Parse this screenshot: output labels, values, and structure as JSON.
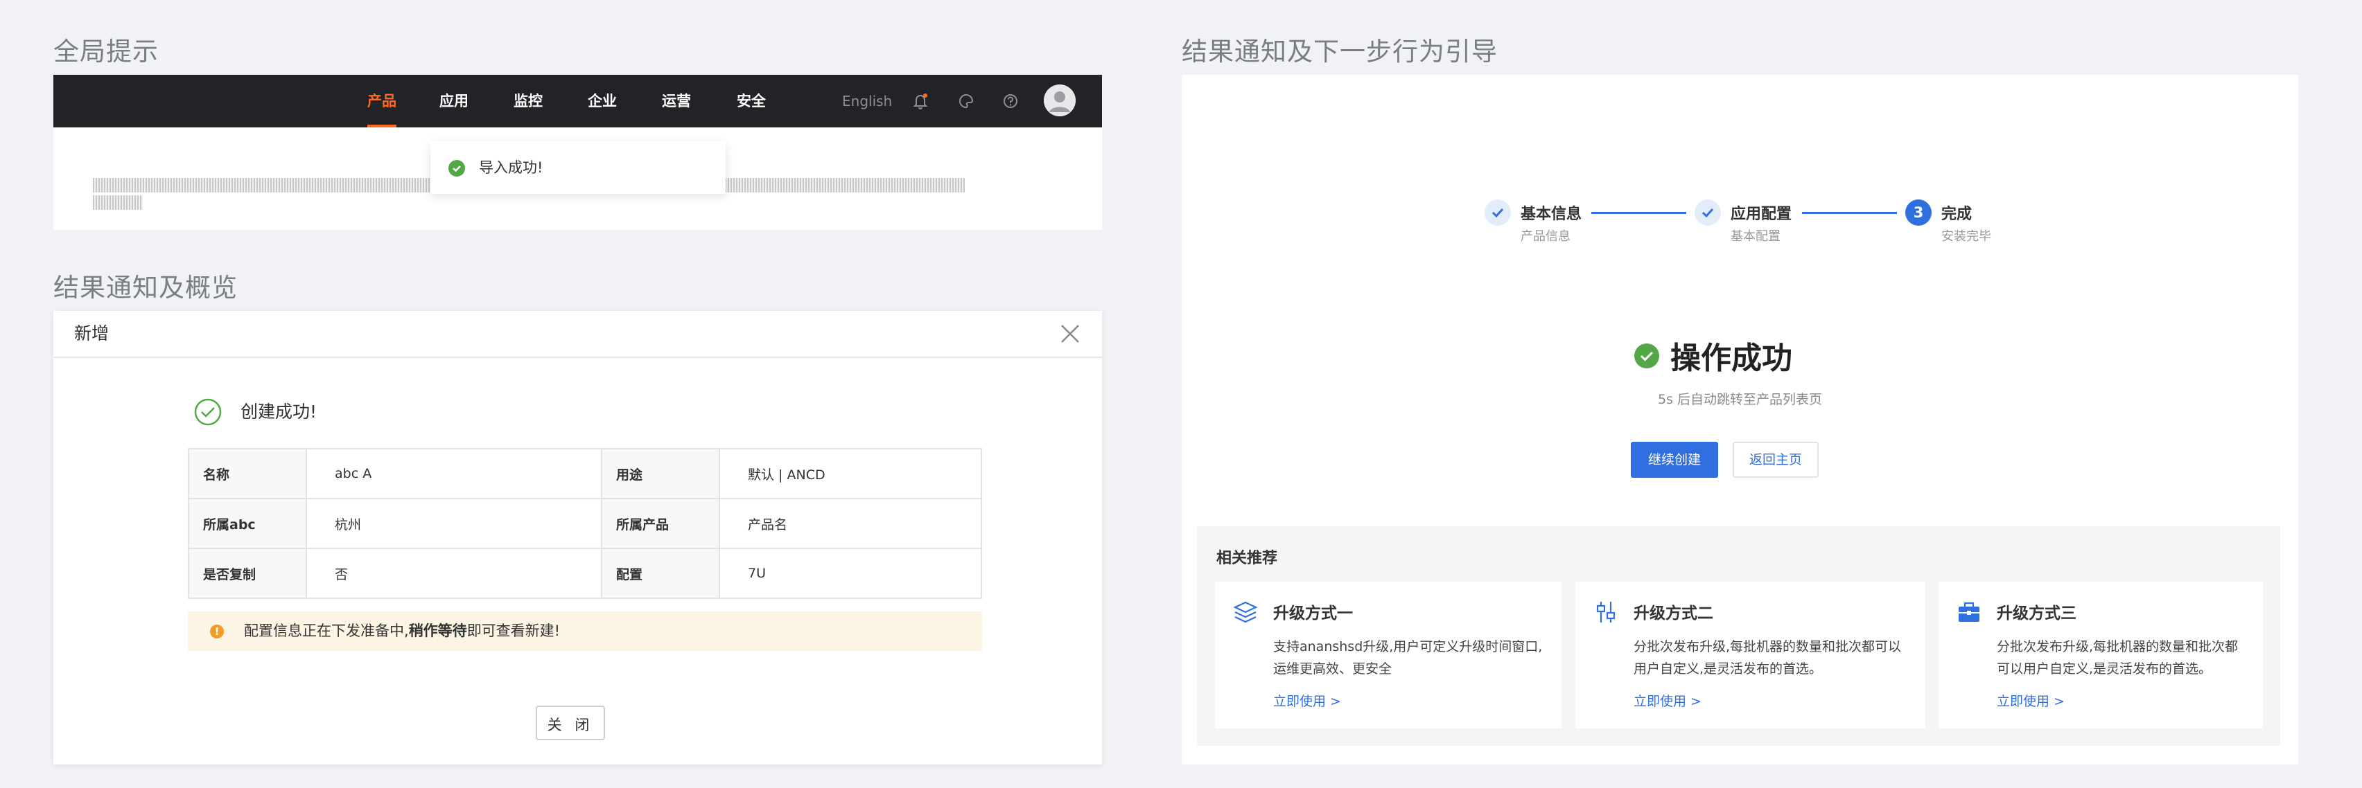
{
  "sections": {
    "global_notice": "全局提示",
    "result_overview": "结果通知及概览",
    "result_guide": "结果通知及下一步行为引导"
  },
  "topnav": {
    "items": [
      "产品",
      "应用",
      "监控",
      "企业",
      "运营",
      "安全"
    ],
    "active_index": 0,
    "lang": "English",
    "icons": [
      "bell-icon",
      "palette-icon",
      "help-icon",
      "avatar"
    ]
  },
  "toast": {
    "text": "导入成功!"
  },
  "dialog": {
    "title": "新增",
    "result_title": "创建成功!",
    "rows": [
      {
        "label1": "名称",
        "value1": "abc A",
        "label2": "用途",
        "value2": "默认 | ANCD"
      },
      {
        "label1": "所属abc",
        "value1": "杭州",
        "label2": "所属产品",
        "value2": "产品名"
      },
      {
        "label1": "是否复制",
        "value1": "否",
        "label2": "配置",
        "value2": "7U"
      }
    ],
    "warning": {
      "prefix": "配置信息正在下发准备中,",
      "bold": "稍作等待",
      "suffix": "即可查看新建!"
    },
    "close_label": "关 闭"
  },
  "steps": [
    {
      "title": "基本信息",
      "desc": "产品信息",
      "status": "done"
    },
    {
      "title": "应用配置",
      "desc": "基本配置",
      "status": "done"
    },
    {
      "title": "完成",
      "desc": "安装完毕",
      "status": "current",
      "number": "3"
    }
  ],
  "success": {
    "title": "操作成功",
    "tip": "5s 后自动跳转至产品列表页",
    "primary_btn": "继续创建",
    "secondary_btn": "返回主页"
  },
  "recommend": {
    "title": "相关推荐",
    "cards": [
      {
        "title": "升级方式一",
        "desc": "支持ananshsd升级,用户可定义升级时间窗口,运维更高效、更安全",
        "link": "立即使用 >",
        "icon": "layers-icon"
      },
      {
        "title": "升级方式二",
        "desc": "分批次发布升级,每批机器的数量和批次都可以用户自定义,是灵活发布的首选。",
        "link": "立即使用 >",
        "icon": "sliders-icon"
      },
      {
        "title": "升级方式三",
        "desc": "分批次发布升级,每批机器的数量和批次都可以用户自定义,是灵活发布的首选。",
        "link": "立即使用 >",
        "icon": "toolbox-icon"
      }
    ]
  },
  "colors": {
    "primary": "#2f6fe0",
    "success": "#52a845",
    "nav_bg": "#222326",
    "nav_active": "#ff6a21",
    "warning": "#f29b26"
  }
}
